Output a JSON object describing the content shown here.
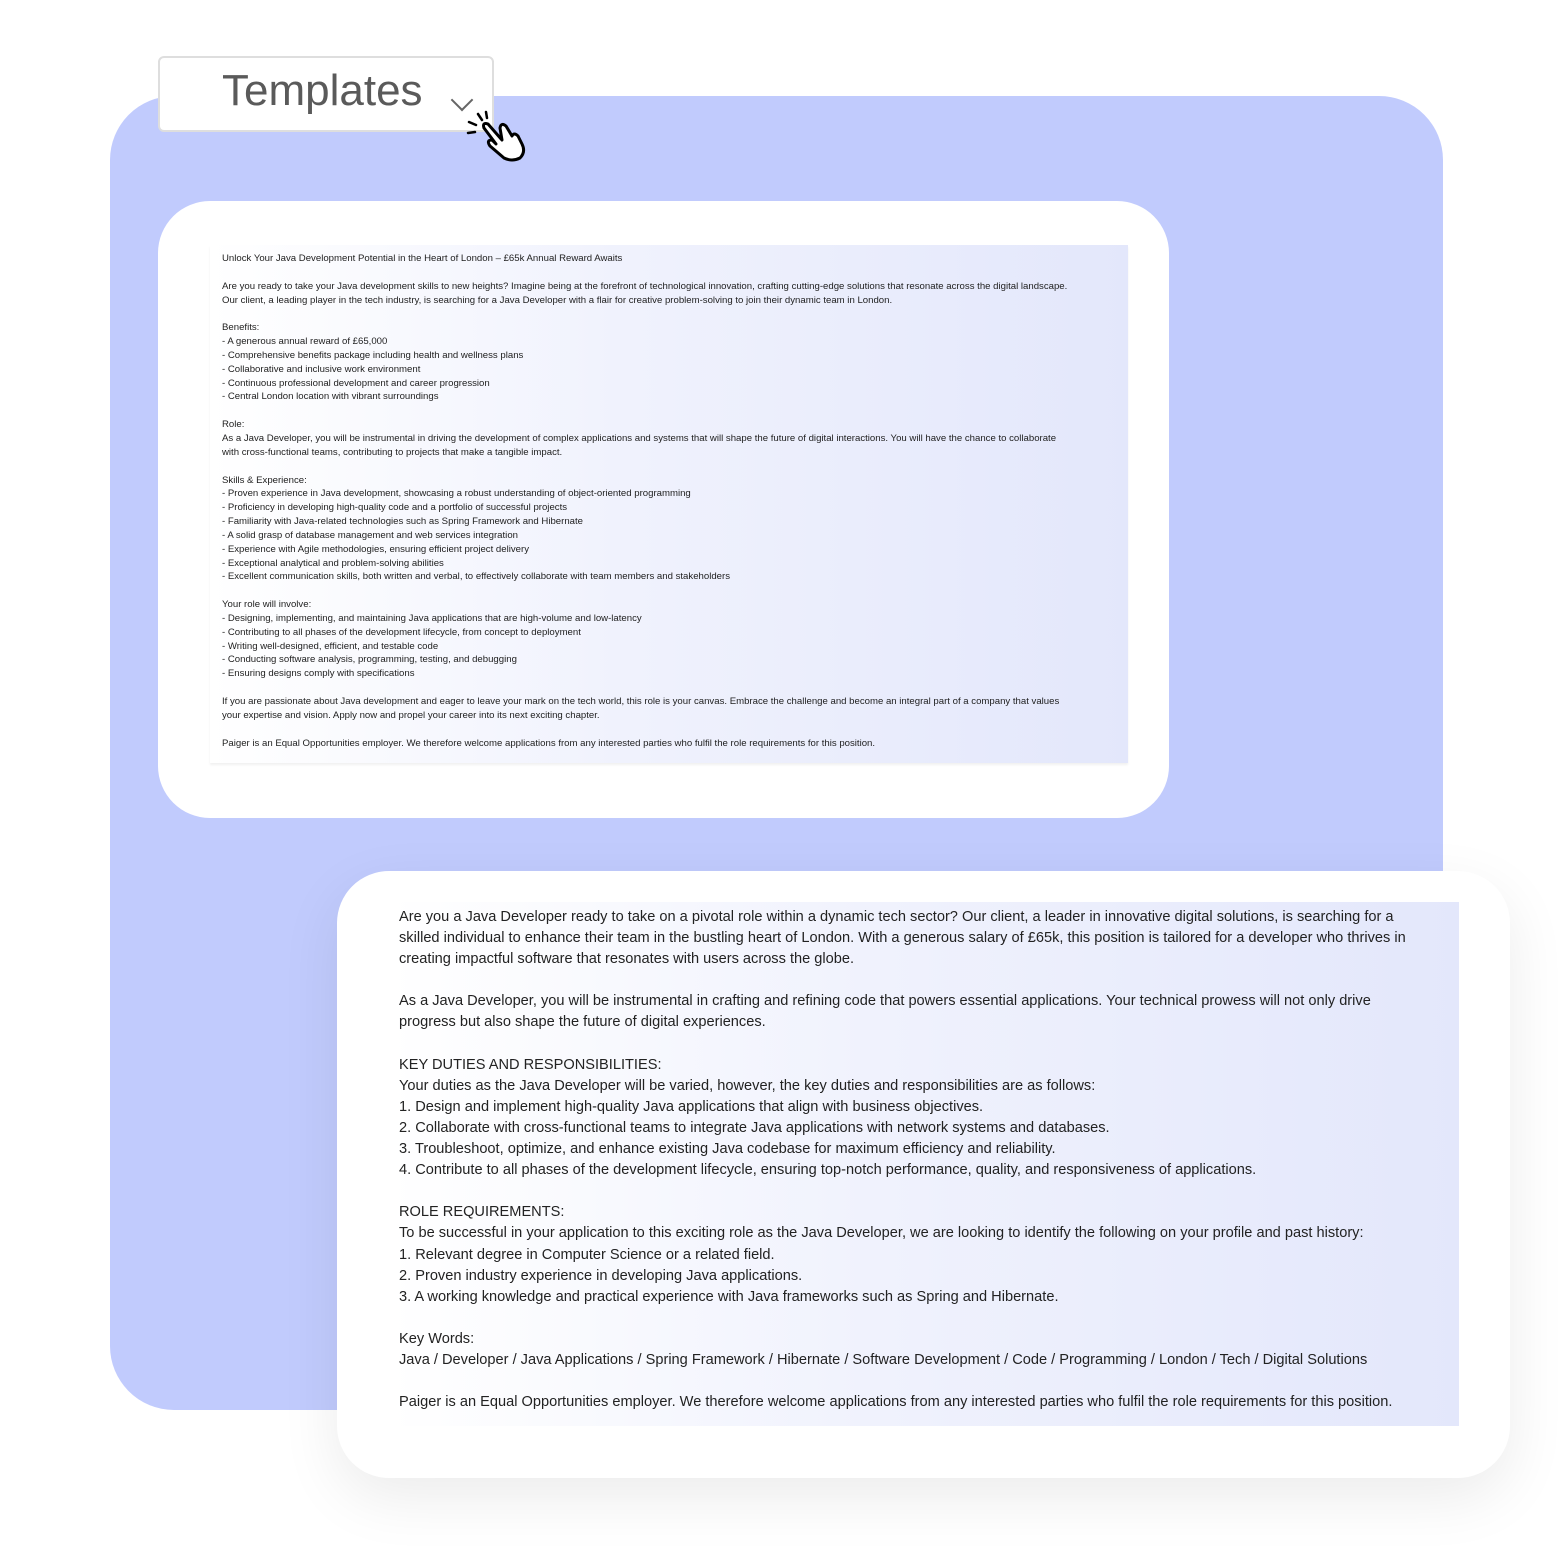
{
  "colors": {
    "panel": "#c1cbfd",
    "card": "#ffffff",
    "text": "#1e1e1e"
  },
  "dropdown": {
    "label": "Templates",
    "icon": "chevron-down-icon"
  },
  "cursor": {
    "icon": "pointer-hand-click-icon"
  },
  "original_document": {
    "lines": [
      "Unlock Your Java Development Potential in the Heart of London – £65k Annual Reward Awaits",
      "",
      "Are you ready to take your Java development skills to new heights? Imagine being at the forefront of technological innovation, crafting cutting-edge solutions that resonate across the digital landscape.",
      "Our client, a leading player in the tech industry, is searching for a Java Developer with a flair for creative problem-solving to join their dynamic team in London.",
      "",
      "Benefits:",
      "- A generous annual reward of £65,000",
      "- Comprehensive benefits package including health and wellness plans",
      "- Collaborative and inclusive work environment",
      "- Continuous professional development and career progression",
      "- Central London location with vibrant surroundings",
      "",
      "Role:",
      "As a Java Developer, you will be instrumental in driving the development of complex applications and systems that will shape the future of digital interactions. You will have the chance to collaborate",
      "with cross-functional teams, contributing to projects that make a tangible impact.",
      "",
      "Skills & Experience:",
      "- Proven experience in Java development, showcasing a robust understanding of object-oriented programming",
      "- Proficiency in developing high-quality code and a portfolio of successful projects",
      "- Familiarity with Java-related technologies such as Spring Framework and Hibernate",
      "- A solid grasp of database management and web services integration",
      "- Experience with Agile methodologies, ensuring efficient project delivery",
      "- Exceptional analytical and problem-solving abilities",
      "- Excellent communication skills, both written and verbal, to effectively collaborate with team members and stakeholders",
      "",
      "Your role will involve:",
      "- Designing, implementing, and maintaining Java applications that are high-volume and low-latency",
      "- Contributing to all phases of the development lifecycle, from concept to deployment",
      "- Writing well-designed, efficient, and testable code",
      "- Conducting software analysis, programming, testing, and debugging",
      "- Ensuring designs comply with specifications",
      "",
      "If you are passionate about Java development and eager to leave your mark on the tech world, this role is your canvas. Embrace the challenge and become an integral part of a company that values",
      "your expertise and vision. Apply now and propel your career into its next exciting chapter.",
      "",
      "Paiger is an Equal Opportunities employer. We therefore welcome applications from any interested parties who fulfil the role requirements for this position."
    ]
  },
  "templated_document": {
    "lines": [
      "Are you a Java Developer ready to take on a pivotal role within a dynamic tech sector? Our client, a leader in innovative digital solutions, is searching for a",
      "skilled individual to enhance their team in the bustling heart of London. With a generous salary of £65k, this position is tailored for a developer who thrives in",
      "creating impactful software that resonates with users across the globe.",
      "",
      "As a Java Developer, you will be instrumental in crafting and refining code that powers essential applications. Your technical prowess will not only drive",
      "progress but also shape the future of digital experiences.",
      "",
      "KEY DUTIES AND RESPONSIBILITIES:",
      "Your duties as the Java Developer will be varied, however, the key duties and responsibilities are as follows:",
      "1. Design and implement high-quality Java applications that align with business objectives.",
      "2. Collaborate with cross-functional teams to integrate Java applications with network systems and databases.",
      "3. Troubleshoot, optimize, and enhance existing Java codebase for maximum efficiency and reliability.",
      "4. Contribute to all phases of the development lifecycle, ensuring top-notch performance, quality, and responsiveness of applications.",
      "",
      "ROLE REQUIREMENTS:",
      "To be successful in your application to this exciting role as the Java Developer, we are looking to identify the following on your profile and past history:",
      "1. Relevant degree in Computer Science or a related field.",
      "2. Proven industry experience in developing Java applications.",
      "3. A working knowledge and practical experience with Java frameworks such as Spring and Hibernate.",
      "",
      "Key Words:",
      "Java / Developer / Java Applications / Spring Framework / Hibernate / Software Development / Code / Programming / London / Tech / Digital Solutions",
      "",
      "Paiger is an Equal Opportunities employer. We therefore welcome applications from any interested parties who fulfil the role requirements for this position."
    ]
  }
}
